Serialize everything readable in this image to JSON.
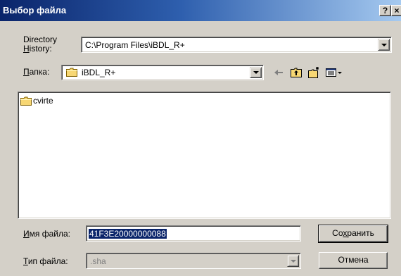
{
  "window": {
    "title": "Выбор файла",
    "help_label": "?",
    "close_label": "×"
  },
  "directory_history": {
    "label_line1": "Directory",
    "label_line2_accel": "H",
    "label_line2_rest": "istory:",
    "value": "C:\\Program Files\\iBDL_R+"
  },
  "folder": {
    "label_accel": "П",
    "label_rest": "апка:",
    "value": "iBDL_R+"
  },
  "file_list": {
    "items": [
      {
        "name": "cvirte",
        "icon": "folder-icon"
      }
    ]
  },
  "filename": {
    "label_accel": "И",
    "label_rest": "мя файла:",
    "value": "41F3E20000000088"
  },
  "filetype": {
    "label_accel": "Т",
    "label_rest": "ип файла:",
    "value": ".sha"
  },
  "buttons": {
    "save_pre": "Со",
    "save_accel": "х",
    "save_post": "ранить",
    "cancel_label": "Отмена"
  },
  "toolbar": {
    "icons": [
      "back-arrow-icon",
      "up-folder-icon",
      "new-folder-icon",
      "view-menu-icon"
    ]
  },
  "colors": {
    "face": "#d4d0c8",
    "title_start": "#0a246a",
    "title_end": "#a6caf0",
    "selection": "#0a246a",
    "folder_yellow": "#f7d774"
  }
}
